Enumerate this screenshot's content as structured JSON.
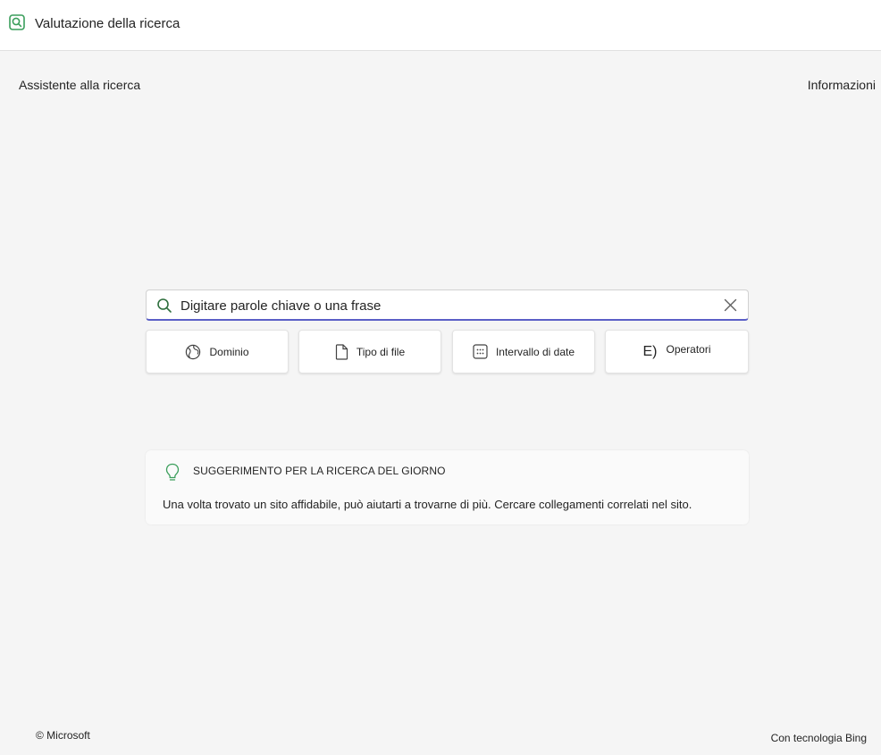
{
  "header": {
    "icon": "search-app-icon",
    "title": "Valutazione della ricerca",
    "accent_color": "#3a9e5b"
  },
  "subnav": {
    "left_label": "Assistente alla ricerca",
    "right_label": "Informazioni"
  },
  "search": {
    "placeholder": "Digitare parole chiave o una frase",
    "value": "",
    "focus_color": "#5b5fc7"
  },
  "filters": [
    {
      "label": "Dominio",
      "icon": "globe-icon"
    },
    {
      "label": "Tipo di file",
      "icon": "document-icon"
    },
    {
      "label": "Intervallo di date",
      "icon": "calendar-icon"
    },
    {
      "label": "Operatori",
      "icon": "operator-glyph",
      "glyph": "E)"
    }
  ],
  "tip": {
    "icon": "lightbulb-icon",
    "heading": "SUGGERIMENTO PER LA RICERCA DEL GIORNO",
    "body": "Una volta trovato un sito affidabile, può aiutarti a trovarne di più. Cercare collegamenti correlati nel sito.",
    "icon_color": "#3a9e5b"
  },
  "footer": {
    "copyright": "© Microsoft",
    "powered_by": "Con tecnologia Bing"
  }
}
